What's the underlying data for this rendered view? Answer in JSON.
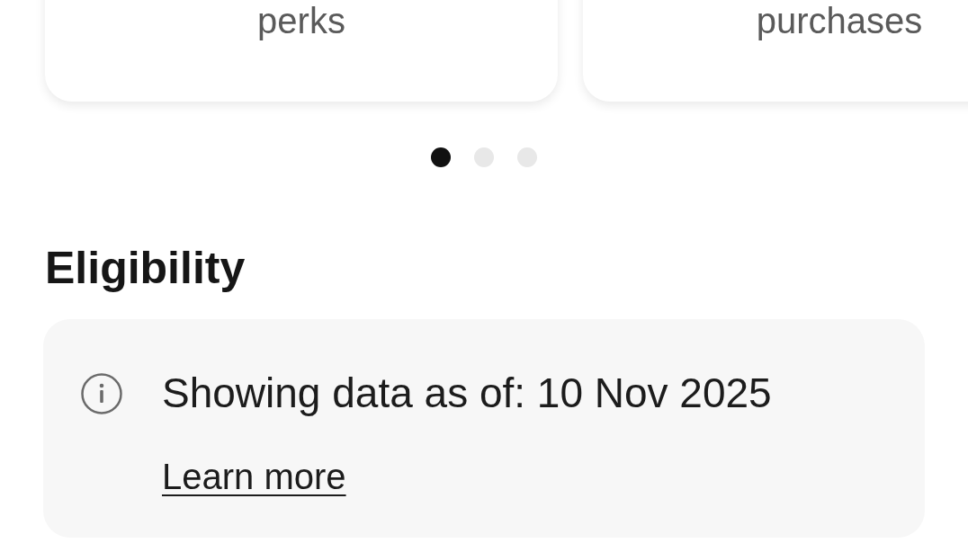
{
  "carousel": {
    "cards": [
      {
        "caption": "perks"
      },
      {
        "caption": "purchases"
      }
    ],
    "dots": [
      {
        "selected": true
      },
      {
        "selected": false
      },
      {
        "selected": false
      }
    ]
  },
  "eligibility": {
    "heading": "Eligibility",
    "notice": {
      "text": "Showing data as of: 10 Nov 2025",
      "link": "Learn more"
    }
  }
}
